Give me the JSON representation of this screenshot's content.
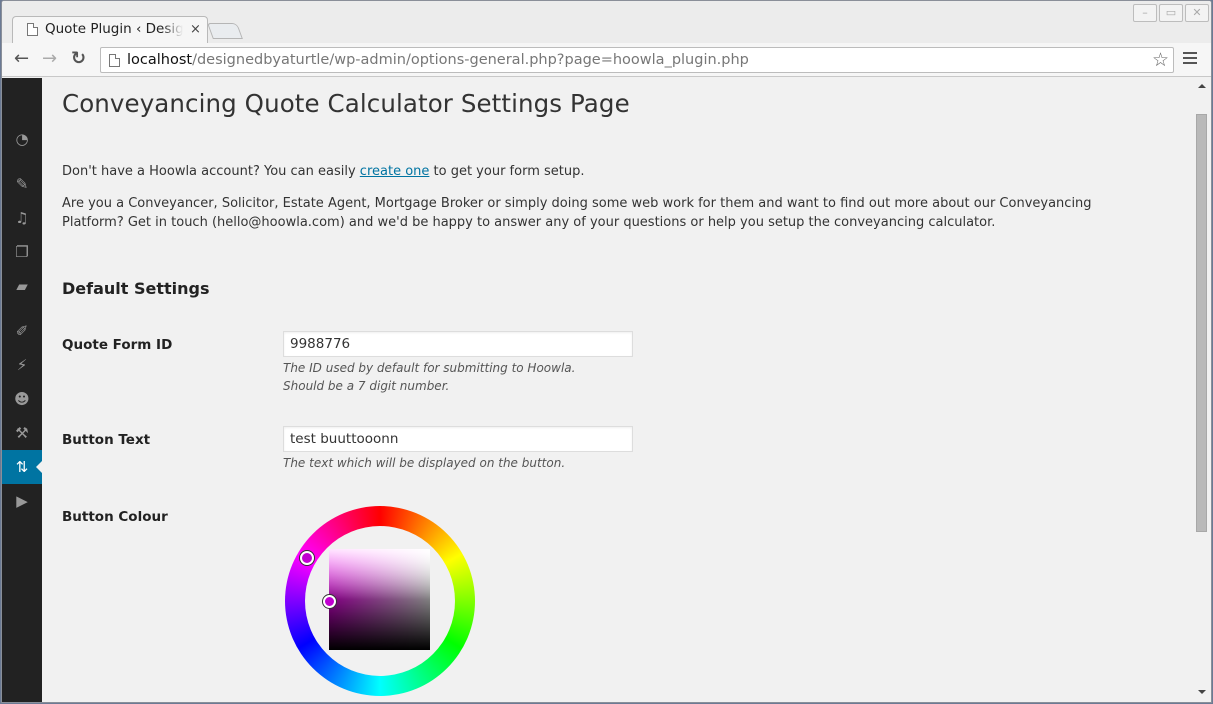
{
  "browser": {
    "tab_title": "Quote Plugin ‹ Designed by a Turtle",
    "tab_close": "×",
    "url_host": "localhost",
    "url_path": "/designedbyaturtle/wp-admin/options-general.php?page=hoowla_plugin.php",
    "back_icon": "←",
    "forward_icon": "→",
    "reload_icon": "↻",
    "star_icon": "☆",
    "window_controls": {
      "minimize": "–",
      "maximize": "▭",
      "close": "✕"
    }
  },
  "admin_menu": {
    "items": [
      {
        "name": "dashboard",
        "icon": "◔"
      },
      {
        "name": "posts",
        "icon": "✎"
      },
      {
        "name": "media",
        "icon": "♫"
      },
      {
        "name": "pages",
        "icon": "❐"
      },
      {
        "name": "comments",
        "icon": "▰"
      },
      {
        "name": "appearance",
        "icon": "✐"
      },
      {
        "name": "plugins",
        "icon": "⚡"
      },
      {
        "name": "users",
        "icon": "☻"
      },
      {
        "name": "tools",
        "icon": "⚒"
      },
      {
        "name": "settings",
        "icon": "⇅",
        "active": true
      },
      {
        "name": "media-player",
        "icon": "▶"
      }
    ]
  },
  "page": {
    "title": "Conveyancing Quote Calculator Settings Page",
    "intro_before_link": "Don't have a Hoowla account? You can easily ",
    "intro_link": "create one",
    "intro_after_link": " to get your form setup.",
    "contact_text": "Are you a Conveyancer, Solicitor, Estate Agent, Mortgage Broker or simply doing some web work for them and want to find out more about our Conveyancing Platform? Get in touch (hello@hoowla.com) and we'd be happy to answer any of your questions or help you setup the conveyancing calculator.",
    "section_title": "Default Settings",
    "fields": {
      "quote_form_id": {
        "label": "Quote Form ID",
        "value": "9988776",
        "help_line1": "The ID used by default for submitting to Hoowla.",
        "help_line2": "Should be a 7 digit number."
      },
      "button_text": {
        "label": "Button Text",
        "value": "test buuttooonn",
        "help": "The text which will be displayed on the button."
      },
      "button_colour": {
        "label": "Button Colour",
        "hue_color": "#ff00ff",
        "selected_color": "#c000d0"
      }
    }
  }
}
